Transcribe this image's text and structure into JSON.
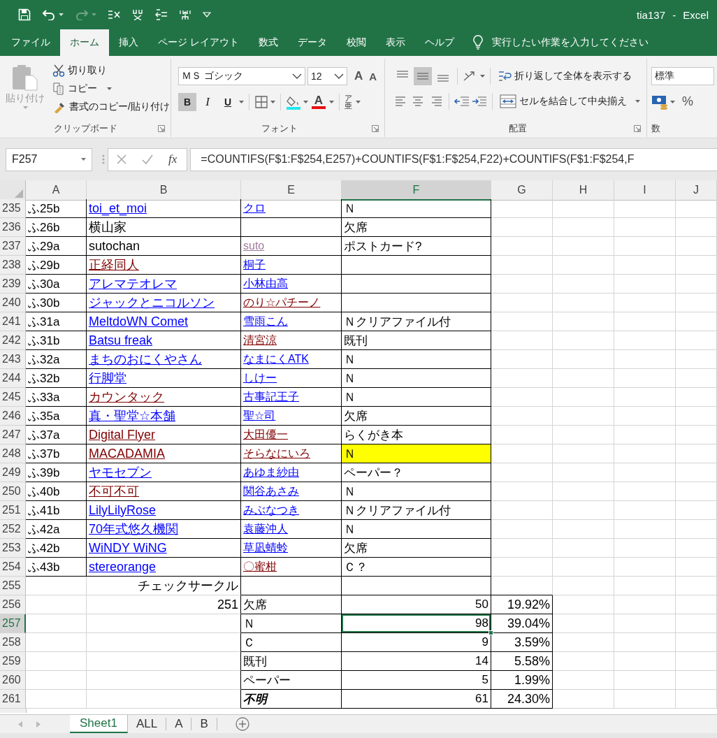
{
  "window": {
    "title": "tia137 - Excel"
  },
  "tabs": [
    {
      "label": "ファイル",
      "selected": false
    },
    {
      "label": "ホーム",
      "selected": true
    },
    {
      "label": "挿入",
      "selected": false
    },
    {
      "label": "ページ レイアウト",
      "selected": false
    },
    {
      "label": "数式",
      "selected": false
    },
    {
      "label": "データ",
      "selected": false
    },
    {
      "label": "校閲",
      "selected": false
    },
    {
      "label": "表示",
      "selected": false
    },
    {
      "label": "ヘルプ",
      "selected": false
    }
  ],
  "tell_me": {
    "label": "実行したい作業を入力してください"
  },
  "ribbon": {
    "clipboard": {
      "title": "クリップボード",
      "paste": {
        "label": "貼り付け",
        "disabled": true
      },
      "cut": "切り取り",
      "copy": "コピー",
      "format_painter": "書式のコピー/貼り付け"
    },
    "font": {
      "title": "フォント",
      "name": "ＭＳ ゴシック",
      "size": "12",
      "grow": "A",
      "shrink": "A",
      "font_color": "A",
      "phonetic": "ア亜",
      "styles": [
        {
          "label": "B",
          "kind": "bold",
          "selected": true
        },
        {
          "label": "I",
          "kind": "italic",
          "selected": false
        },
        {
          "label": "U",
          "kind": "underline",
          "selected": false
        }
      ]
    },
    "alignment": {
      "title": "配置",
      "wrap": "折り返して全体を表示する",
      "merge": "セルを結合して中央揃え",
      "vertical_align": [
        {
          "selected": false
        },
        {
          "selected": true
        },
        {
          "selected": false
        }
      ]
    },
    "number": {
      "title": "数",
      "format": "標準",
      "percent": "%"
    }
  },
  "formula_bar": {
    "name_box": "F257",
    "function_button": "fx",
    "formula": "=COUNTIFS(F$1:F$254,E257)+COUNTIFS(F$1:F$254,F22)+COUNTIFS(F$1:F$254,F"
  },
  "columns": [
    {
      "label": "A",
      "selected": false
    },
    {
      "label": "B",
      "selected": false
    },
    {
      "label": "E",
      "selected": false
    },
    {
      "label": "F",
      "selected": true
    },
    {
      "label": "G",
      "selected": false
    },
    {
      "label": "H",
      "selected": false
    },
    {
      "label": "I",
      "selected": false
    },
    {
      "label": "J",
      "selected": false
    }
  ],
  "rows": [
    {
      "header": "235",
      "a": "ふ25b",
      "b": {
        "text": "toi_et_moi",
        "color": "#0000ff",
        "link": true
      },
      "e": {
        "text": "クロ",
        "color": "#0000ff",
        "link": true
      },
      "f": {
        "text": "Ｎ",
        "highlighted": false
      }
    },
    {
      "header": "236",
      "a": "ふ26b",
      "b": {
        "text": "横山家",
        "color": "#000000",
        "link": false
      },
      "f": {
        "text": "欠席",
        "highlighted": false
      }
    },
    {
      "header": "237",
      "a": "ふ29a",
      "b": {
        "text": "sutochan",
        "color": "#000000",
        "link": false
      },
      "e": {
        "text": "suto",
        "color": "#9e7b9e",
        "link": true
      },
      "f": {
        "text": "ポストカード?",
        "highlighted": false
      }
    },
    {
      "header": "238",
      "a": "ふ29b",
      "b": {
        "text": "正経同人",
        "color": "#800000",
        "link": true
      },
      "e": {
        "text": "桐子",
        "color": "#0000ff",
        "link": true
      },
      "f": {
        "highlighted": false
      }
    },
    {
      "header": "239",
      "a": "ふ30a",
      "b": {
        "text": "アレマテオレマ",
        "color": "#0000ff",
        "link": true
      },
      "e": {
        "text": "小林由高",
        "color": "#0000ff",
        "link": true
      },
      "f": {
        "highlighted": false
      }
    },
    {
      "header": "240",
      "a": "ふ30b",
      "b": {
        "text": "ジャックとニコルソン",
        "color": "#0000ff",
        "link": true
      },
      "e": {
        "text": "のり☆パチーノ",
        "color": "#800000",
        "link": true
      },
      "f": {
        "highlighted": false
      }
    },
    {
      "header": "241",
      "a": "ふ31a",
      "b": {
        "text": "MeltdoWN Comet",
        "color": "#0000ff",
        "link": true
      },
      "e": {
        "text": "雪雨こん",
        "color": "#0000ff",
        "link": true
      },
      "f": {
        "text": "Ｎクリアファイル付",
        "highlighted": false
      }
    },
    {
      "header": "242",
      "a": "ふ31b",
      "b": {
        "text": "Batsu freak",
        "color": "#0000ff",
        "link": true
      },
      "e": {
        "text": "清宮涼",
        "color": "#800000",
        "link": true
      },
      "f": {
        "text": "既刊",
        "highlighted": false
      }
    },
    {
      "header": "243",
      "a": "ふ32a",
      "b": {
        "text": "まちのおにくやさん",
        "color": "#0000ff",
        "link": true
      },
      "e": {
        "text": "なまにくATK",
        "color": "#0000ff",
        "link": true
      },
      "f": {
        "text": "Ｎ",
        "highlighted": false
      }
    },
    {
      "header": "244",
      "a": "ふ32b",
      "b": {
        "text": "行脚堂",
        "color": "#0000ff",
        "link": true
      },
      "e": {
        "text": "しけー",
        "color": "#0000ff",
        "link": true
      },
      "f": {
        "text": "Ｎ",
        "highlighted": false
      }
    },
    {
      "header": "245",
      "a": "ふ33a",
      "b": {
        "text": "カウンタック",
        "color": "#800000",
        "link": true
      },
      "e": {
        "text": "古事記王子",
        "color": "#0000ff",
        "link": true
      },
      "f": {
        "text": "Ｎ",
        "highlighted": false
      }
    },
    {
      "header": "246",
      "a": "ふ35a",
      "b": {
        "text": "真・聖堂☆本舗",
        "color": "#0000ff",
        "link": true
      },
      "e": {
        "text": "聖☆司",
        "color": "#0000ff",
        "link": true
      },
      "f": {
        "text": "欠席",
        "highlighted": false
      }
    },
    {
      "header": "247",
      "a": "ふ37a",
      "b": {
        "text": "Digital Flyer",
        "color": "#800000",
        "link": true
      },
      "e": {
        "text": "大田優一",
        "color": "#800000",
        "link": true
      },
      "f": {
        "text": "らくがき本",
        "highlighted": false
      }
    },
    {
      "header": "248",
      "a": "ふ37b",
      "b": {
        "text": "MACADAMIA",
        "color": "#800000",
        "link": true
      },
      "e": {
        "text": "そらなにいろ",
        "color": "#800000",
        "link": true
      },
      "f": {
        "text": "Ｎ",
        "highlighted": true
      }
    },
    {
      "header": "249",
      "a": "ふ39b",
      "b": {
        "text": "ヤモセブン",
        "color": "#0000ff",
        "link": true
      },
      "e": {
        "text": "あゆま紗由",
        "color": "#0000ff",
        "link": true
      },
      "f": {
        "text": "ペーパー？",
        "highlighted": false
      }
    },
    {
      "header": "250",
      "a": "ふ40b",
      "b": {
        "text": "不可不可",
        "color": "#800000",
        "link": true
      },
      "e": {
        "text": "関谷あさみ",
        "color": "#0000ff",
        "link": true
      },
      "f": {
        "text": "Ｎ",
        "highlighted": false
      }
    },
    {
      "header": "251",
      "a": "ふ41b",
      "b": {
        "text": "LilyLilyRose",
        "color": "#0000ff",
        "link": true
      },
      "e": {
        "text": "みぶなつき",
        "color": "#0000ff",
        "link": true
      },
      "f": {
        "text": "Ｎクリアファイル付",
        "highlighted": false
      }
    },
    {
      "header": "252",
      "a": "ふ42a",
      "b": {
        "text": "70年式悠久機関",
        "color": "#0000ff",
        "link": true
      },
      "e": {
        "text": "袁藤沖人",
        "color": "#0000ff",
        "link": true
      },
      "f": {
        "text": "Ｎ",
        "highlighted": false
      }
    },
    {
      "header": "253",
      "a": "ふ42b",
      "b": {
        "text": "WiNDY WiNG",
        "color": "#0000ff",
        "link": true
      },
      "e": {
        "text": "草凪蜻蛉",
        "color": "#0000ff",
        "link": true
      },
      "f": {
        "text": "欠席",
        "highlighted": false
      }
    },
    {
      "header": "254",
      "a": "ふ43b",
      "b": {
        "text": "stereorange",
        "color": "#0000ff",
        "link": true
      },
      "e": {
        "text": "〇蜜柑",
        "color": "#800000",
        "link": true
      },
      "f": {
        "text": "Ｃ？",
        "highlighted": false
      }
    }
  ],
  "summary": {
    "title_row": "255",
    "title": "チェックサークル",
    "total": "251",
    "items": [
      {
        "row": "256",
        "label": "欠席",
        "count": "50",
        "percent": "19.92%",
        "selected": false,
        "emphasis": false
      },
      {
        "row": "257",
        "label": "Ｎ",
        "count": "98",
        "percent": "39.04%",
        "selected": true,
        "emphasis": false
      },
      {
        "row": "258",
        "label": "Ｃ",
        "count": "9",
        "percent": "3.59%",
        "selected": false,
        "emphasis": false
      },
      {
        "row": "259",
        "label": "既刊",
        "count": "14",
        "percent": "5.58%",
        "selected": false,
        "emphasis": false
      },
      {
        "row": "260",
        "label": "ペーパー",
        "count": "5",
        "percent": "1.99%",
        "selected": false,
        "emphasis": false
      },
      {
        "row": "261",
        "label": "不明",
        "count": "61",
        "percent": "24.30%",
        "selected": false,
        "emphasis": true
      }
    ]
  },
  "sheet_tabs": [
    {
      "label": "Sheet1",
      "selected": true
    },
    {
      "label": "ALL",
      "selected": false
    },
    {
      "label": "A",
      "selected": false
    },
    {
      "label": "B",
      "selected": false
    }
  ]
}
